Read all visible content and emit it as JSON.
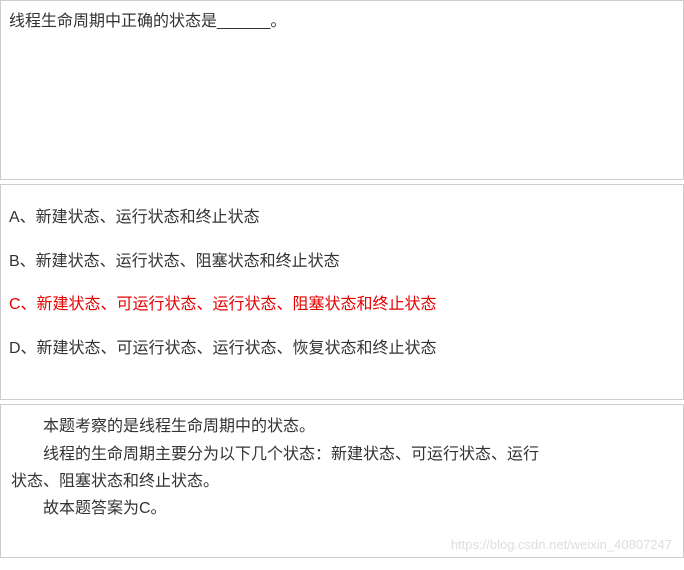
{
  "question": {
    "text": "线程生命周期中正确的状态是______。"
  },
  "options": [
    {
      "label": "A、新建状态、运行状态和终止状态",
      "correct": false
    },
    {
      "label": "B、新建状态、运行状态、阻塞状态和终止状态",
      "correct": false
    },
    {
      "label": "C、新建状态、可运行状态、运行状态、阻塞状态和终止状态",
      "correct": true
    },
    {
      "label": "D、新建状态、可运行状态、运行状态、恢复状态和终止状态",
      "correct": false
    }
  ],
  "explanation": {
    "line1": "本题考察的是线程生命周期中的状态。",
    "line2": "线程的生命周期主要分为以下几个状态：新建状态、可运行状态、运行",
    "line3": "状态、阻塞状态和终止状态。",
    "line4": "故本题答案为C。"
  },
  "watermark": "https://blog.csdn.net/weixin_40807247"
}
